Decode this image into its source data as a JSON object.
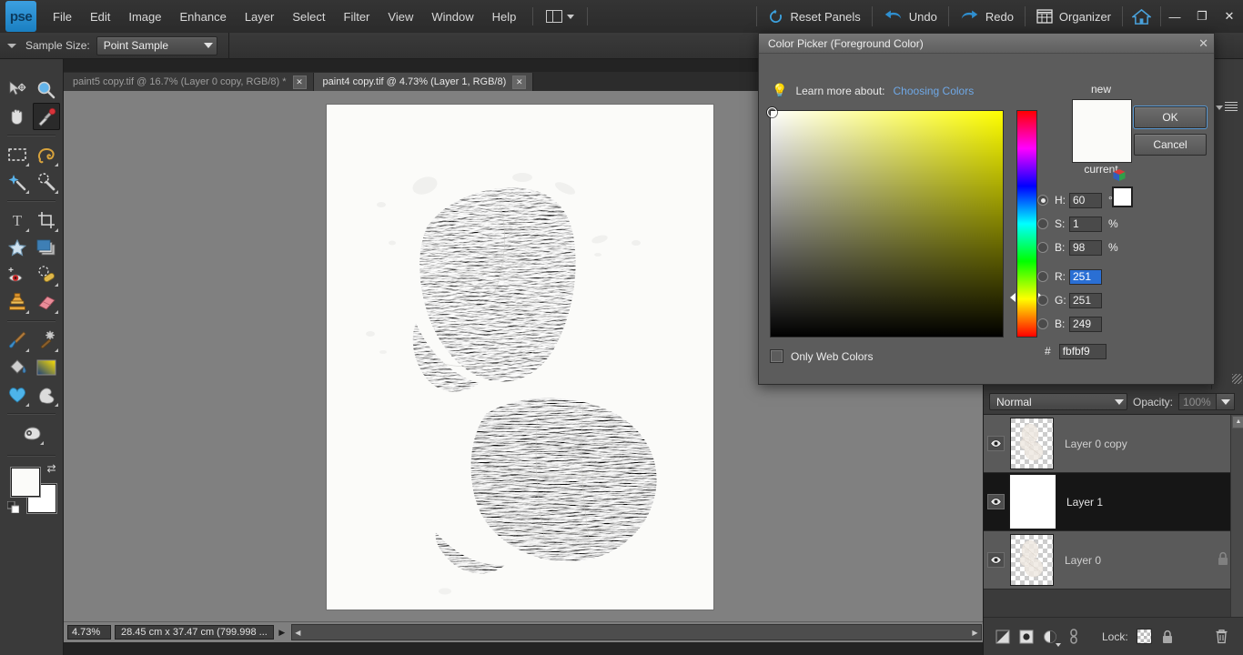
{
  "app": {
    "logo_text": "pse"
  },
  "menubar": {
    "items": [
      "File",
      "Edit",
      "Image",
      "Enhance",
      "Layer",
      "Select",
      "Filter",
      "View",
      "Window",
      "Help"
    ],
    "right_buttons": [
      {
        "label": "Reset Panels",
        "icon": "reset-icon"
      },
      {
        "label": "Undo",
        "icon": "undo-icon"
      },
      {
        "label": "Redo",
        "icon": "redo-icon"
      },
      {
        "label": "Organizer",
        "icon": "organizer-icon"
      }
    ],
    "home_icon": "home-icon",
    "window_buttons": {
      "minimize": "—",
      "maximize": "❐",
      "close": "✕"
    }
  },
  "optionsbar": {
    "label": "Sample Size:",
    "sample_size_value": "Point Sample"
  },
  "tabs": [
    {
      "title": "paint5 copy.tif @ 16.7% (Layer 0 copy, RGB/8) *",
      "active": false,
      "close": "✕"
    },
    {
      "title": "paint4 copy.tif @ 4.73% (Layer 1, RGB/8)",
      "active": true,
      "close": "✕"
    }
  ],
  "toolbar": {
    "tools": [
      {
        "name": "move-tool",
        "selected": false,
        "submenu": false
      },
      {
        "name": "zoom-tool",
        "selected": false,
        "submenu": false
      },
      {
        "name": "hand-tool",
        "selected": false,
        "submenu": false
      },
      {
        "name": "eyedropper-tool",
        "selected": true,
        "submenu": false
      },
      {
        "name": "rectangular-marquee-tool",
        "selected": false,
        "submenu": true
      },
      {
        "name": "lasso-tool",
        "selected": false,
        "submenu": true
      },
      {
        "name": "quick-selection-tool",
        "selected": false,
        "submenu": true
      },
      {
        "name": "magic-wand-tool",
        "selected": false,
        "submenu": true
      },
      {
        "name": "type-tool",
        "selected": false,
        "submenu": true
      },
      {
        "name": "crop-tool",
        "selected": false,
        "submenu": true
      },
      {
        "name": "cookie-cutter-tool",
        "selected": false,
        "submenu": false
      },
      {
        "name": "recompose-tool",
        "selected": false,
        "submenu": false
      },
      {
        "name": "red-eye-removal-tool",
        "selected": false,
        "submenu": false
      },
      {
        "name": "spot-healing-brush-tool",
        "selected": false,
        "submenu": true
      },
      {
        "name": "clone-stamp-tool",
        "selected": false,
        "submenu": true
      },
      {
        "name": "eraser-tool",
        "selected": false,
        "submenu": true
      },
      {
        "name": "brush-tool",
        "selected": false,
        "submenu": true
      },
      {
        "name": "smart-brush-tool",
        "selected": false,
        "submenu": true
      },
      {
        "name": "paint-bucket-tool",
        "selected": false,
        "submenu": false
      },
      {
        "name": "gradient-tool",
        "selected": false,
        "submenu": false
      },
      {
        "name": "custom-shape-tool",
        "selected": false,
        "submenu": true
      },
      {
        "name": "blur-tool",
        "selected": false,
        "submenu": true
      },
      {
        "name": "sponge-tool",
        "selected": false,
        "submenu": true
      }
    ],
    "foreground_color": "#fbfbf9",
    "background_color": "#ffffff",
    "swap_icon": "swap-colors-icon",
    "default_icon": "default-colors-icon"
  },
  "statusbar": {
    "zoom": "4.73%",
    "dimensions": "28.45 cm x 37.47 cm (799.998 ..."
  },
  "layers_panel": {
    "blend_mode": "Normal",
    "opacity_label": "Opacity:",
    "opacity_value": "100%",
    "layers": [
      {
        "name": "Layer 0 copy",
        "visible": true,
        "active": false,
        "locked": false,
        "thumb": "transparent"
      },
      {
        "name": "Layer 1",
        "visible": true,
        "active": true,
        "locked": false,
        "thumb": "white"
      },
      {
        "name": "Layer 0",
        "visible": true,
        "active": false,
        "locked": true,
        "thumb": "transparent"
      }
    ],
    "footer": {
      "lock_label": "Lock:",
      "buttons": [
        "new-layer-icon",
        "adjustment-layer-icon",
        "fill-layer-icon",
        "link-layers-icon"
      ],
      "lock_transparency_icon": "lock-transparency-icon",
      "lock_all_icon": "lock-all-icon",
      "delete_icon": "trash-icon"
    }
  },
  "color_picker": {
    "title": "Color Picker (Foreground Color)",
    "close": "✕",
    "learn_prefix": "Learn more about:",
    "learn_link": "Choosing Colors",
    "bulb_icon": "lightbulb-icon",
    "new_label": "new",
    "current_label": "current",
    "new_color": "#fbfbf9",
    "current_color": "#ffffff",
    "ok_label": "OK",
    "cancel_label": "Cancel",
    "only_web_colors_label": "Only Web Colors",
    "only_web_colors_checked": false,
    "cube_icon": "color-cube-icon",
    "fields": [
      {
        "key": "H",
        "label": "H:",
        "value": "60",
        "unit": "°",
        "selected_radio": true,
        "highlighted": false
      },
      {
        "key": "S",
        "label": "S:",
        "value": "1",
        "unit": "%",
        "selected_radio": false,
        "highlighted": false
      },
      {
        "key": "B",
        "label": "B:",
        "value": "98",
        "unit": "%",
        "selected_radio": false,
        "highlighted": false
      },
      {
        "key": "R",
        "label": "R:",
        "value": "251",
        "unit": "",
        "selected_radio": false,
        "highlighted": true
      },
      {
        "key": "G",
        "label": "G:",
        "value": "251",
        "unit": "",
        "selected_radio": false,
        "highlighted": false
      },
      {
        "key": "B2",
        "label": "B:",
        "value": "249",
        "unit": "",
        "selected_radio": false,
        "highlighted": false
      }
    ],
    "hex_label": "#",
    "hex_value": "fbfbf9",
    "hue_degrees": 60
  }
}
